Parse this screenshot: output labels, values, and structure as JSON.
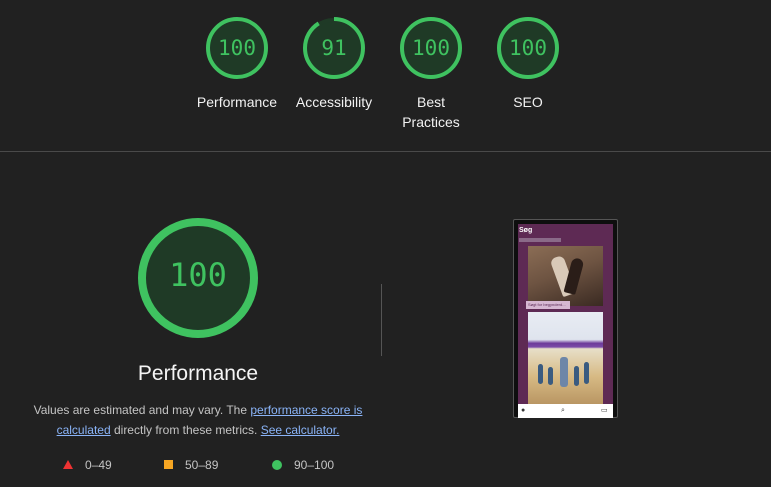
{
  "gauges": [
    {
      "score": "100",
      "label": "Performance",
      "fraction": 1.0
    },
    {
      "score": "91",
      "label": "Accessibility",
      "fraction": 0.91
    },
    {
      "score": "100",
      "label": "Best Practices",
      "fraction": 1.0
    },
    {
      "score": "100",
      "label": "SEO",
      "fraction": 1.0
    }
  ],
  "main": {
    "score": "100",
    "fraction": 1.0,
    "title": "Performance",
    "desc_part1": "Values are estimated and may vary. The ",
    "link1": "performance score is calculated",
    "desc_part2": " directly from these metrics. ",
    "link2": "See calculator."
  },
  "legend": {
    "fail": "0–49",
    "average": "50–89",
    "pass": "90–100"
  },
  "screenshot": {
    "title": "Søg",
    "caption": "Søgt for begynderd..."
  },
  "colors": {
    "pass": "#3fc260",
    "average": "#f6a623",
    "fail": "#ee3333",
    "background": "#212121"
  }
}
